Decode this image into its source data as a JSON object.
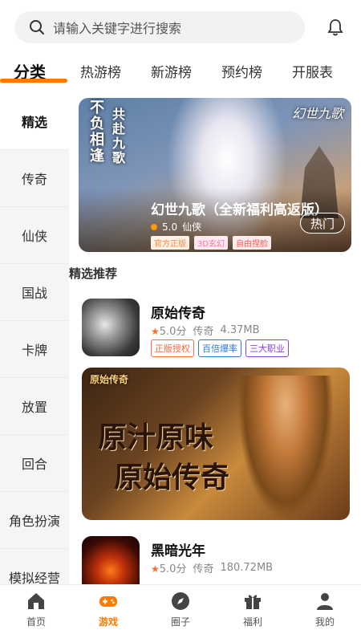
{
  "search": {
    "placeholder": "请输入关键字进行搜索"
  },
  "tabs": [
    {
      "label": "分类",
      "active": true
    },
    {
      "label": "热游榜"
    },
    {
      "label": "新游榜"
    },
    {
      "label": "预约榜"
    },
    {
      "label": "开服表"
    }
  ],
  "categories": [
    {
      "label": "精选",
      "active": true
    },
    {
      "label": "传奇"
    },
    {
      "label": "仙侠"
    },
    {
      "label": "国战"
    },
    {
      "label": "卡牌"
    },
    {
      "label": "放置"
    },
    {
      "label": "回合"
    },
    {
      "label": "角色扮演"
    },
    {
      "label": "模拟经营"
    }
  ],
  "banner": {
    "vertical_left": "不负相逢",
    "vertical_right": "共赴九歌",
    "logo": "幻世九歌",
    "title": "幻世九歌（全新福利高返版）",
    "rating": "5.0",
    "genre": "仙侠",
    "hot_label": "热门",
    "tags": [
      {
        "label": "官方正版",
        "color": "#ff8a3d",
        "bg": "#fff1e6"
      },
      {
        "label": "3D玄幻",
        "color": "#ff6fa0",
        "bg": "#ffeaf2"
      },
      {
        "label": "自由捏脸",
        "color": "#ff5a5a",
        "bg": "#ffecec"
      }
    ]
  },
  "section": {
    "title": "精选推荐"
  },
  "apps": [
    {
      "name": "原始传奇",
      "rating": "5.0分",
      "genre": "传奇",
      "size": "4.37MB",
      "tags": [
        {
          "label": "正版授权",
          "color": "#ff6a3d"
        },
        {
          "label": "百倍爆率",
          "color": "#2f7bd8"
        },
        {
          "label": "三大职业",
          "color": "#8a3fd8"
        }
      ]
    },
    {
      "name": "黑暗光年",
      "rating": "5.0分",
      "genre": "传奇",
      "size": "180.72MB",
      "tags": []
    }
  ],
  "poster": {
    "mini_logo": "原始传奇",
    "line1": "原汁原味",
    "line2": "原始传奇"
  },
  "bottom_nav": [
    {
      "label": "首页",
      "icon": "home-icon"
    },
    {
      "label": "游戏",
      "icon": "gamepad-icon",
      "active": true
    },
    {
      "label": "圈子",
      "icon": "compass-icon"
    },
    {
      "label": "福利",
      "icon": "gift-icon"
    },
    {
      "label": "我的",
      "icon": "user-icon"
    }
  ],
  "colors": {
    "accent": "#ff7a00",
    "star": "#ff6a2b"
  }
}
